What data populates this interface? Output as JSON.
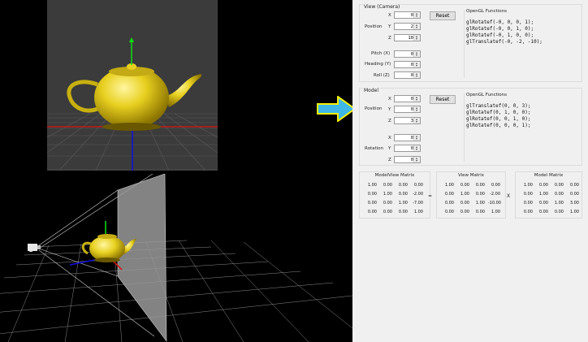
{
  "camera": {
    "title": "View (Camera)",
    "position_label": "Position",
    "x_label": "X",
    "y_label": "Y",
    "z_label": "Z",
    "x": "0",
    "y": "2",
    "z": "10",
    "pitch_label": "Pitch (X)",
    "heading_label": "Heading (Y)",
    "roll_label": "Roll (Z)",
    "pitch": "0",
    "heading": "0",
    "roll": "0",
    "reset_label": "Reset",
    "gl_title": "OpenGL Functions",
    "gl_lines": [
      "glRotatef(-0, 0, 0, 1);",
      "glRotatef(-0, 0, 1, 0);",
      "glRotatef(-0, 1, 0, 0);",
      "glTranslatef(-0, -2, -10);"
    ]
  },
  "model": {
    "title": "Model",
    "position_label": "Position",
    "rotation_label": "Rotation",
    "x_label": "X",
    "y_label": "Y",
    "z_label": "Z",
    "px": "0",
    "py": "0",
    "pz": "3",
    "rx": "0",
    "ry": "0",
    "rz": "0",
    "reset_label": "Reset",
    "gl_title": "OpenGL Functions",
    "gl_lines": [
      "glTranslatef(0, 0, 3);",
      "glRotatef(0, 1, 0, 0);",
      "glRotatef(0, 0, 1, 0);",
      "glRotatef(0, 0, 0, 1);"
    ]
  },
  "matrices": {
    "modelview": {
      "title": "ModelView Matrix",
      "rows": [
        [
          "1.00",
          "0.00",
          "0.00",
          "0.00"
        ],
        [
          "0.00",
          "1.00",
          "0.00",
          "-2.00"
        ],
        [
          "0.00",
          "0.00",
          "1.00",
          "-7.00"
        ],
        [
          "0.00",
          "0.00",
          "0.00",
          "1.00"
        ]
      ]
    },
    "view": {
      "title": "View Matrix",
      "rows": [
        [
          "1.00",
          "0.00",
          "0.00",
          "0.00"
        ],
        [
          "0.00",
          "1.00",
          "0.00",
          "-2.00"
        ],
        [
          "0.00",
          "0.00",
          "1.00",
          "-10.00"
        ],
        [
          "0.00",
          "0.00",
          "0.00",
          "1.00"
        ]
      ]
    },
    "model": {
      "title": "Model Matrix",
      "rows": [
        [
          "1.00",
          "0.00",
          "0.00",
          "0.00"
        ],
        [
          "0.00",
          "1.00",
          "0.00",
          "0.00"
        ],
        [
          "0.00",
          "0.00",
          "1.00",
          "3.00"
        ],
        [
          "0.00",
          "0.00",
          "0.00",
          "1.00"
        ]
      ]
    },
    "equals": "=",
    "times": "X"
  },
  "colors": {
    "viewport_bg": "#3b3b3b",
    "panel_bg": "#f0f0f0",
    "teapot": "#e8d020",
    "arrow": "#3fb8e8",
    "arrow_outline": "#f4f000",
    "axis_x": "#e01010",
    "axis_y": "#10e010",
    "axis_z": "#1010e0"
  }
}
